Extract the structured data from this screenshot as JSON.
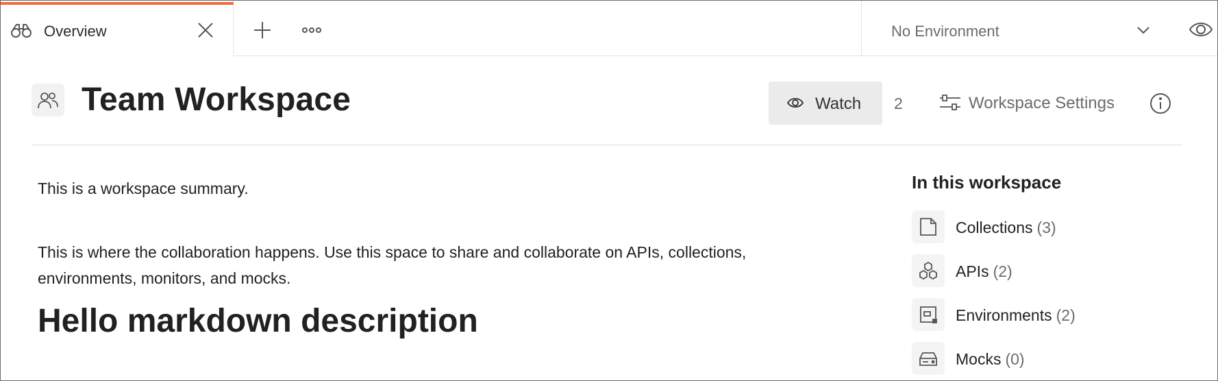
{
  "tabbar": {
    "active_tab": {
      "label": "Overview",
      "icon": "binoculars-icon"
    },
    "new_tab_icon": "plus-icon",
    "more_icon": "ellipsis-icon",
    "environment": {
      "selected": "No Environment"
    },
    "accent_color": "#f26b3a"
  },
  "header": {
    "title": "Team Workspace",
    "watch_label": "Watch",
    "watch_count": "2",
    "settings_label": "Workspace Settings"
  },
  "main": {
    "summary": "This is a workspace summary.",
    "paragraph": "This is where the collaboration happens. Use this space to share and collaborate on APIs, collections, environments, monitors, and mocks.",
    "heading": "Hello markdown description"
  },
  "sidebar": {
    "title": "In this workspace",
    "items": [
      {
        "label": "Collections",
        "count": "(3)",
        "icon": "collection-icon"
      },
      {
        "label": "APIs",
        "count": "(2)",
        "icon": "api-icon"
      },
      {
        "label": "Environments",
        "count": "(2)",
        "icon": "environment-icon"
      },
      {
        "label": "Mocks",
        "count": "(0)",
        "icon": "mock-server-icon"
      }
    ]
  }
}
